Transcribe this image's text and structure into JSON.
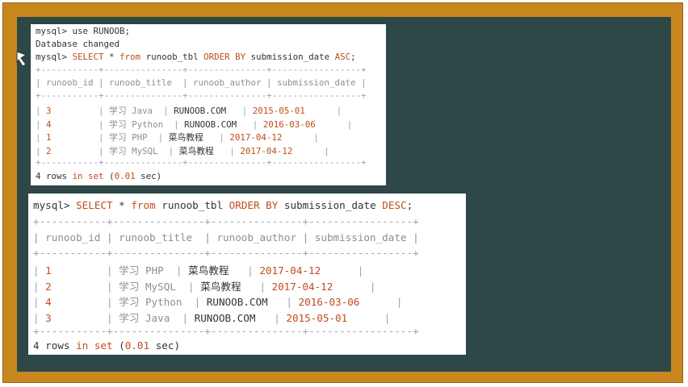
{
  "colors": {
    "frame": "#c8861f",
    "board": "#2e4848",
    "keyword": "#c04d1b",
    "border_dashes": "#9aa3ad"
  },
  "terminal_1": {
    "line1_prompt": "mysql> ",
    "line1_cmd": "use RUNOOB;",
    "line2": "Database changed",
    "line3_prompt": "mysql> ",
    "line3_kw1": "SELECT",
    "line3_mid1": " * ",
    "line3_kw2": "from",
    "line3_mid2": " runoob_tbl ",
    "line3_kw3": "ORDER BY",
    "line3_mid3": " submission_date ",
    "line3_kw4": "ASC",
    "line3_end": ";",
    "border": "+-----------+---------------+---------------+-----------------+",
    "header": "| runoob_id | runoob_title  | runoob_author | submission_date |",
    "rows": [
      {
        "id": "3",
        "title": "学习 Java",
        "author": "RUNOOB.COM",
        "date": "2015-05-01"
      },
      {
        "id": "4",
        "title": "学习 Python",
        "author": "RUNOOB.COM",
        "date": "2016-03-06"
      },
      {
        "id": "1",
        "title": "学习 PHP",
        "author": "菜鸟教程",
        "date": "2017-04-12"
      },
      {
        "id": "2",
        "title": "学习 MySQL",
        "author": "菜鸟教程",
        "date": "2017-04-12"
      }
    ],
    "footer_a": "4 rows ",
    "footer_kw1": "in",
    "footer_b": " ",
    "footer_kw2": "set",
    "footer_c": " (",
    "footer_num": "0.01",
    "footer_d": " sec)"
  },
  "terminal_2": {
    "line1_prompt": "mysql> ",
    "line1_kw1": "SELECT",
    "line1_mid1": " * ",
    "line1_kw2": "from",
    "line1_mid2": " runoob_tbl ",
    "line1_kw3": "ORDER BY",
    "line1_mid3": " submission_date ",
    "line1_kw4": "DESC",
    "line1_end": ";",
    "border": "+-----------+---------------+---------------+-----------------+",
    "header": "| runoob_id | runoob_title  | runoob_author | submission_date |",
    "rows": [
      {
        "id": "1",
        "title": "学习 PHP",
        "author": "菜鸟教程",
        "date": "2017-04-12"
      },
      {
        "id": "2",
        "title": "学习 MySQL",
        "author": "菜鸟教程",
        "date": "2017-04-12"
      },
      {
        "id": "4",
        "title": "学习 Python",
        "author": "RUNOOB.COM",
        "date": "2016-03-06"
      },
      {
        "id": "3",
        "title": "学习 Java",
        "author": "RUNOOB.COM",
        "date": "2015-05-01"
      }
    ],
    "footer_a": "4 rows ",
    "footer_kw1": "in",
    "footer_b": " ",
    "footer_kw2": "set",
    "footer_c": " (",
    "footer_num": "0.01",
    "footer_d": " sec)"
  }
}
